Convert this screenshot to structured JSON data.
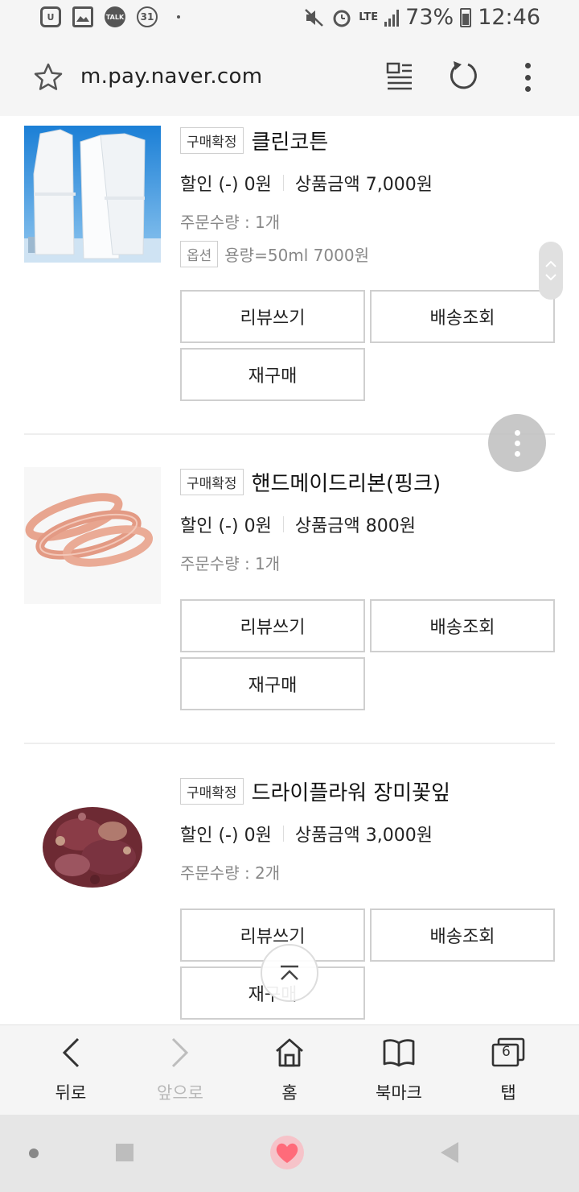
{
  "status_bar": {
    "battery": "73%",
    "time": "12:46",
    "network": "LTE",
    "talk_label": "TALK",
    "calendar_day": "31",
    "icons": [
      "u-plus-icon",
      "gallery-icon",
      "kakaotalk-icon",
      "calendar-icon",
      "mute-icon",
      "alarm-icon",
      "lte-icon",
      "signal-icon",
      "battery-icon"
    ]
  },
  "browser": {
    "url": "m.pay.naver.com"
  },
  "orders": [
    {
      "badge": "구매확정",
      "name": "클린코튼",
      "discount": "할인 (-) 0원",
      "price": "상품금액 7,000원",
      "quantity": "주문수량 : 1개",
      "option_label": "옵션",
      "option_value": "용량=50ml 7000원",
      "buttons": {
        "review": "리뷰쓰기",
        "delivery": "배송조회",
        "rebuy": "재구매"
      }
    },
    {
      "badge": "구매확정",
      "name": "핸드메이드리본(핑크)",
      "discount": "할인 (-) 0원",
      "price": "상품금액 800원",
      "quantity": "주문수량 : 1개",
      "buttons": {
        "review": "리뷰쓰기",
        "delivery": "배송조회",
        "rebuy": "재구매"
      }
    },
    {
      "badge": "구매확정",
      "name": "드라이플라워 장미꽃잎",
      "discount": "할인 (-) 0원",
      "price": "상품금액 3,000원",
      "quantity": "주문수량 : 2개",
      "buttons": {
        "review": "리뷰쓰기",
        "delivery": "배송조회",
        "rebuy": "재구매"
      }
    }
  ],
  "bottom_nav": {
    "back": "뒤로",
    "forward": "앞으로",
    "home": "홈",
    "bookmark": "북마크",
    "tabs": "탭",
    "tab_count": "6"
  },
  "colors": {
    "background": "#ffffff",
    "bar_background": "#f5f5f5",
    "border": "#cfcfcf",
    "muted_text": "#888888",
    "home_heart": "#ff6b7a"
  }
}
